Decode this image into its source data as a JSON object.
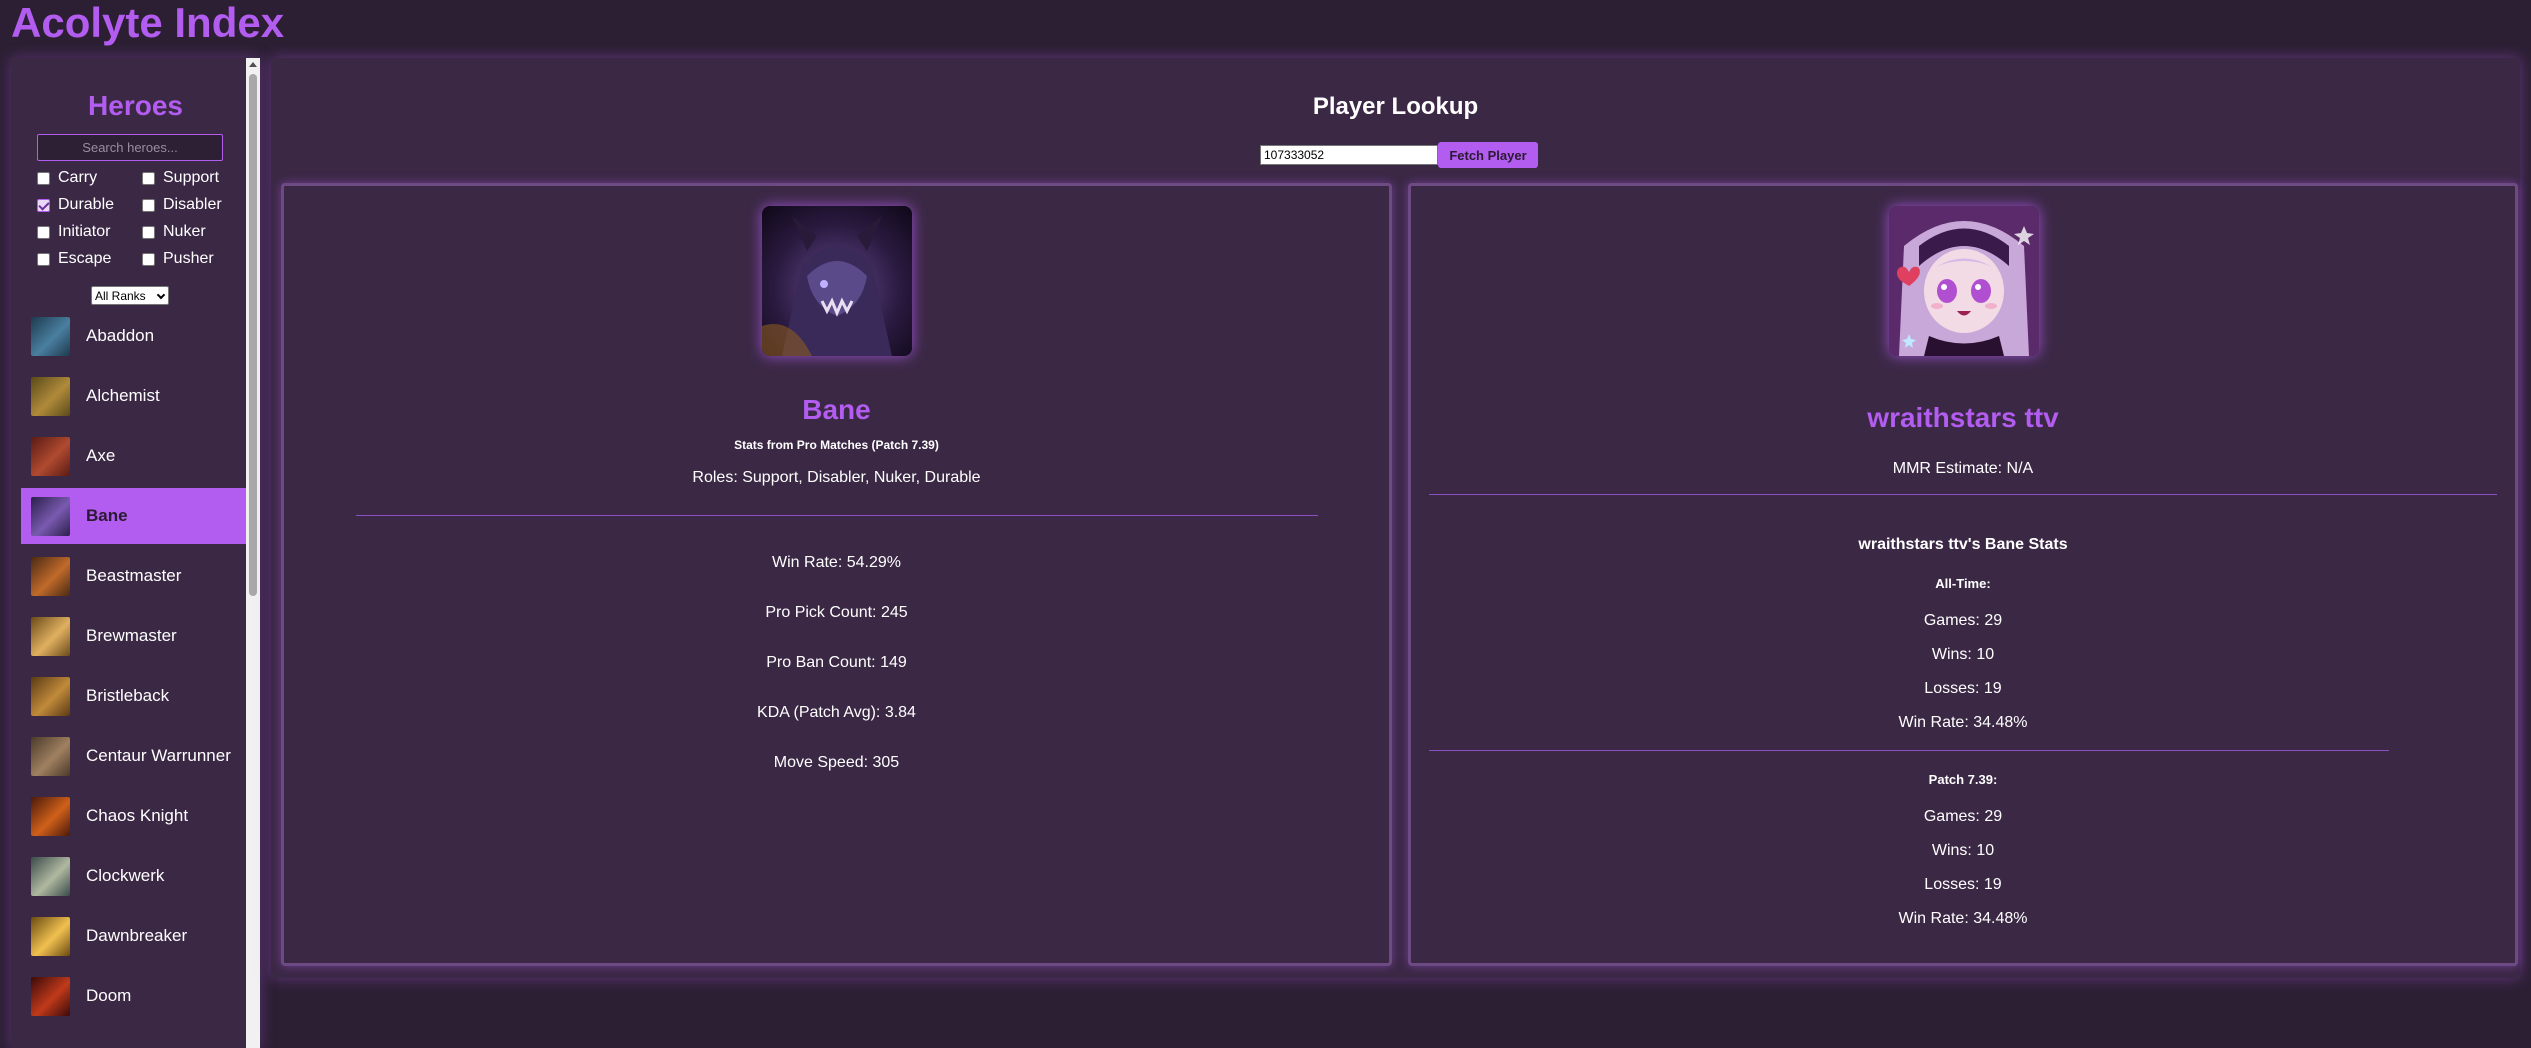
{
  "app": {
    "title": "Acolyte Index"
  },
  "sidebar": {
    "heading": "Heroes",
    "search_placeholder": "Search heroes...",
    "roles": [
      {
        "label": "Carry",
        "checked": false
      },
      {
        "label": "Support",
        "checked": false
      },
      {
        "label": "Durable",
        "checked": true
      },
      {
        "label": "Disabler",
        "checked": false
      },
      {
        "label": "Initiator",
        "checked": false
      },
      {
        "label": "Nuker",
        "checked": false
      },
      {
        "label": "Escape",
        "checked": false
      },
      {
        "label": "Pusher",
        "checked": false
      }
    ],
    "rank_filter": "All Ranks",
    "heroes": [
      {
        "name": "Abaddon",
        "thumb_colors": [
          "#1d3a4d",
          "#4a7fa0"
        ]
      },
      {
        "name": "Alchemist",
        "thumb_colors": [
          "#5a4a1a",
          "#b08a3a"
        ]
      },
      {
        "name": "Axe",
        "thumb_colors": [
          "#5a1a14",
          "#b04a30"
        ]
      },
      {
        "name": "Bane",
        "thumb_colors": [
          "#2b1f4a",
          "#7a5ab0"
        ]
      },
      {
        "name": "Beastmaster",
        "thumb_colors": [
          "#4a2a14",
          "#c06a2a"
        ]
      },
      {
        "name": "Brewmaster",
        "thumb_colors": [
          "#6a4a1a",
          "#e0b060"
        ]
      },
      {
        "name": "Bristleback",
        "thumb_colors": [
          "#5a3a14",
          "#c08a3a"
        ]
      },
      {
        "name": "Centaur Warrunner",
        "thumb_colors": [
          "#4a3a2a",
          "#a08060"
        ]
      },
      {
        "name": "Chaos Knight",
        "thumb_colors": [
          "#4a1a0a",
          "#d0601a"
        ]
      },
      {
        "name": "Clockwerk",
        "thumb_colors": [
          "#3a4a4a",
          "#b0b8a0"
        ]
      },
      {
        "name": "Dawnbreaker",
        "thumb_colors": [
          "#6a4a10",
          "#f0c050"
        ]
      },
      {
        "name": "Doom",
        "thumb_colors": [
          "#3a0a0a",
          "#c03a1a"
        ]
      }
    ],
    "selected_hero": "Bane"
  },
  "lookup": {
    "title": "Player Lookup",
    "player_id": "107333052",
    "fetch_label": "Fetch Player"
  },
  "hero_card": {
    "name": "Bane",
    "subtitle": "Stats from Pro Matches (Patch 7.39)",
    "roles": "Roles: Support, Disabler, Nuker, Durable",
    "stats": [
      "Win Rate: 54.29%",
      "Pro Pick Count: 245",
      "Pro Ban Count: 149",
      "KDA (Patch Avg): 3.84",
      "Move Speed: 305"
    ]
  },
  "player_card": {
    "name": "wraithstars ttv",
    "mmr": "MMR Estimate: N/A",
    "hero_stats_heading": "wraithstars ttv's Bane Stats",
    "all_time_label": "All-Time:",
    "all_time": [
      "Games: 29",
      "Wins: 10",
      "Losses: 19",
      "Win Rate: 34.48%"
    ],
    "patch_label": "Patch 7.39:",
    "patch": [
      "Games: 29",
      "Wins: 10",
      "Losses: 19",
      "Win Rate: 34.48%"
    ]
  },
  "colors": {
    "accent": "#b35cf0",
    "background": "#2c1f33",
    "panel": "#3b2845"
  }
}
